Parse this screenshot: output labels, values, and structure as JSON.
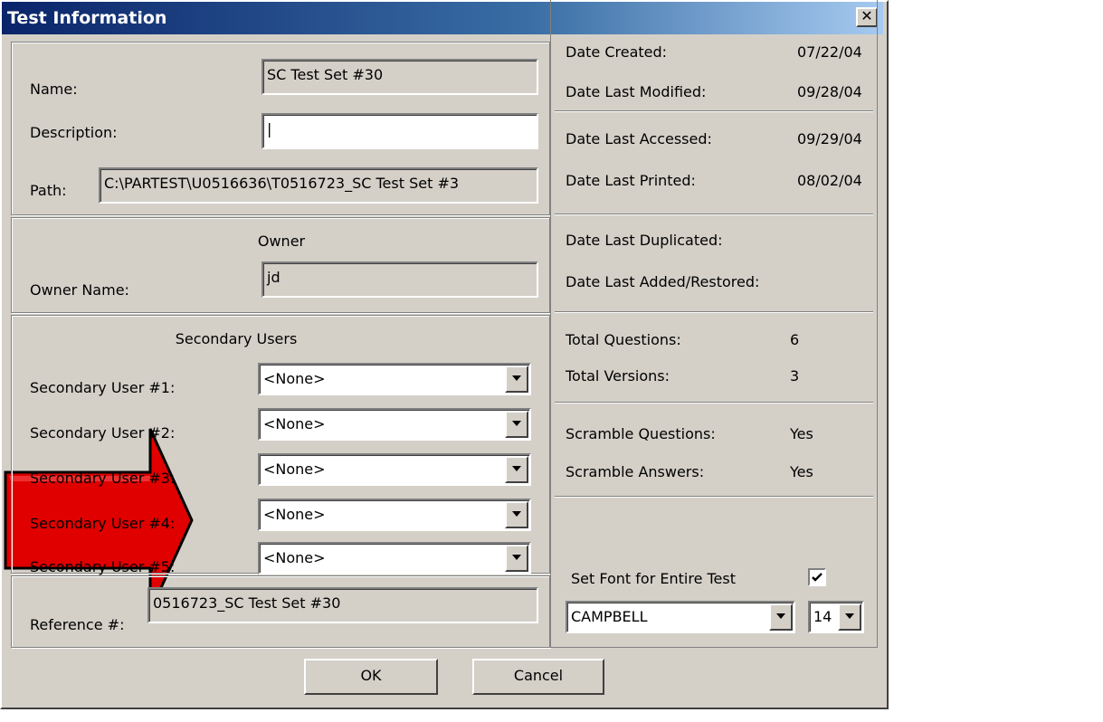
{
  "colors": {
    "arrow": "#e00000",
    "titlebar": "#0a246a",
    "dialog": "#d4d0c8"
  },
  "annotation": {
    "icon": "red-arrow-pointer"
  },
  "dialog": {
    "title": "Test Information",
    "close_glyph": "✕",
    "name_label": "Name:",
    "name_value": "SC Test Set #30",
    "description_label": "Description:",
    "description_value": "|",
    "path_label": "Path:",
    "path_value": "C:\\PARTEST\\U0516636\\T0516723_SC Test Set #3",
    "owner_header": "Owner",
    "owner_name_label": "Owner Name:",
    "owner_name_value": "jd",
    "secondary_header": "Secondary Users",
    "secondary_users": [
      {
        "label": "Secondary User #1:",
        "value": "<None>"
      },
      {
        "label": "Secondary User #2:",
        "value": "<None>"
      },
      {
        "label": "Secondary User #3:",
        "value": "<None>"
      },
      {
        "label": "Secondary User #4:",
        "value": "<None>"
      },
      {
        "label": "Secondary User #5:",
        "value": "<None>"
      }
    ],
    "reference_label": "Reference #:",
    "reference_value": "0516723_SC Test Set #30",
    "dates": {
      "created_label": "Date Created:",
      "created": "07/22/04",
      "modified_label": "Date Last Modified:",
      "modified": "09/28/04",
      "accessed_label": "Date Last Accessed:",
      "accessed": "09/29/04",
      "printed_label": "Date Last Printed:",
      "printed": "08/02/04",
      "duplicated_label": "Date Last Duplicated:",
      "added_label": "Date Last Added/Restored:"
    },
    "totals": {
      "questions_label": "Total Questions:",
      "questions": "6",
      "versions_label": "Total Versions:",
      "versions": "3"
    },
    "scramble": {
      "questions_label": "Scramble Questions:",
      "questions": "Yes",
      "answers_label": "Scramble Answers:",
      "answers": "Yes"
    },
    "font": {
      "set_font_label": "Set Font for Entire Test",
      "set_font_checked": true,
      "font_name": "CAMPBELL",
      "font_size": "14"
    },
    "ok_label": "OK",
    "cancel_label": "Cancel"
  }
}
